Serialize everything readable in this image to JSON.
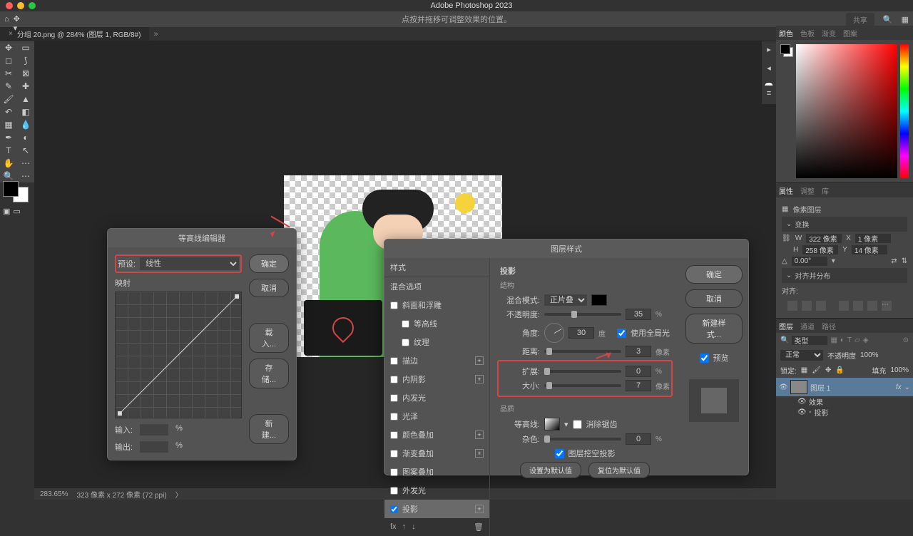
{
  "app": {
    "title": "Adobe Photoshop 2023"
  },
  "menubar": {
    "hint": "点按并拖移可调整效果的位置。",
    "share": "共享"
  },
  "doctab": {
    "title": "分组 20.png @ 284% (图层 1, RGB/8#)"
  },
  "statusbar": {
    "zoom": "283.65%",
    "dims": "323 像素 x 272 像素 (72 ppi)"
  },
  "panels": {
    "color_tabs": [
      "颜色",
      "色板",
      "渐变",
      "图案"
    ],
    "props_tabs": [
      "属性",
      "调整",
      "库"
    ],
    "props_kind": "像素图层",
    "transform": {
      "title": "变换",
      "w": "322 像素",
      "h": "258 像素",
      "x": "1 像素",
      "y": "14 像素",
      "angle": "0.00°"
    },
    "align": {
      "title": "对齐并分布",
      "label": "对齐:"
    },
    "layer_tabs": [
      "图层",
      "通道",
      "路径"
    ],
    "layer_kind": "类型",
    "blend": "正常",
    "opacity_label": "不透明度",
    "opacity": "100%",
    "lock_label": "锁定:",
    "fill_label": "填充",
    "fill": "100%",
    "layers": [
      {
        "name": "图层 1",
        "fx": "fx"
      },
      {
        "effects": "效果"
      },
      {
        "effect": "投影"
      }
    ]
  },
  "contour_dlg": {
    "title": "等高线编辑器",
    "preset_label": "预设:",
    "preset_value": "线性",
    "map": "映射",
    "input": "输入:",
    "output": "输出:",
    "pct": "%",
    "buttons": {
      "ok": "确定",
      "cancel": "取消",
      "load": "载入...",
      "save": "存储...",
      "new": "新建..."
    }
  },
  "style_dlg": {
    "title": "图层样式",
    "styles_hdr": "样式",
    "blend_opts": "混合选项",
    "effects": {
      "bevel": "斜面和浮雕",
      "contour": "等高线",
      "texture": "纹理",
      "stroke": "描边",
      "inner_shadow": "内阴影",
      "inner_glow": "内发光",
      "satin": "光泽",
      "color_overlay": "颜色叠加",
      "grad_overlay": "渐变叠加",
      "pat_overlay": "图案叠加",
      "outer_glow": "外发光",
      "drop_shadow": "投影"
    },
    "section": "投影",
    "struct": "结构",
    "blend_mode_label": "混合模式:",
    "blend_mode": "正片叠底",
    "opacity_label": "不透明度:",
    "opacity": "35",
    "opacity_unit": "%",
    "angle_label": "角度:",
    "angle": "30",
    "angle_unit": "度",
    "global_light": "使用全局光",
    "distance_label": "距离:",
    "distance": "3",
    "px": "像素",
    "spread_label": "扩展:",
    "spread": "0",
    "spread_unit": "%",
    "size_label": "大小:",
    "size": "7",
    "quality": "品质",
    "contour_label": "等高线:",
    "antialias": "消除锯齿",
    "noise_label": "杂色:",
    "noise": "0",
    "knockout": "图层挖空投影",
    "make_default": "设置为默认值",
    "reset_default": "复位为默认值",
    "buttons": {
      "ok": "确定",
      "cancel": "取消",
      "new_style": "新建样式...",
      "preview": "预览"
    }
  }
}
